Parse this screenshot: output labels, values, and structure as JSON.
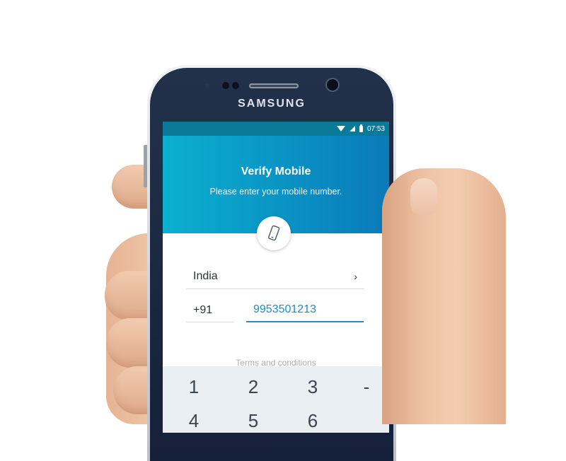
{
  "phone": {
    "brand": "SAMSUNG",
    "status_time": "07:53"
  },
  "screen": {
    "title": "Verify Mobile",
    "subtitle": "Please enter your mobile number.",
    "country": "India",
    "country_chevron": "›",
    "country_code": "+91",
    "mobile_number": "9953501213",
    "terms_link": "Terms and conditions"
  },
  "keypad": {
    "keys": [
      "1",
      "2",
      "3",
      "-",
      "4",
      "5",
      "6"
    ]
  },
  "colors": {
    "header_gradient_start": "#0bb0cf",
    "header_gradient_end": "#0b7ab9",
    "accent": "#1f91c8"
  },
  "icons": [
    "wifi-icon",
    "signal-icon",
    "battery-icon",
    "mobile-phone-icon"
  ]
}
